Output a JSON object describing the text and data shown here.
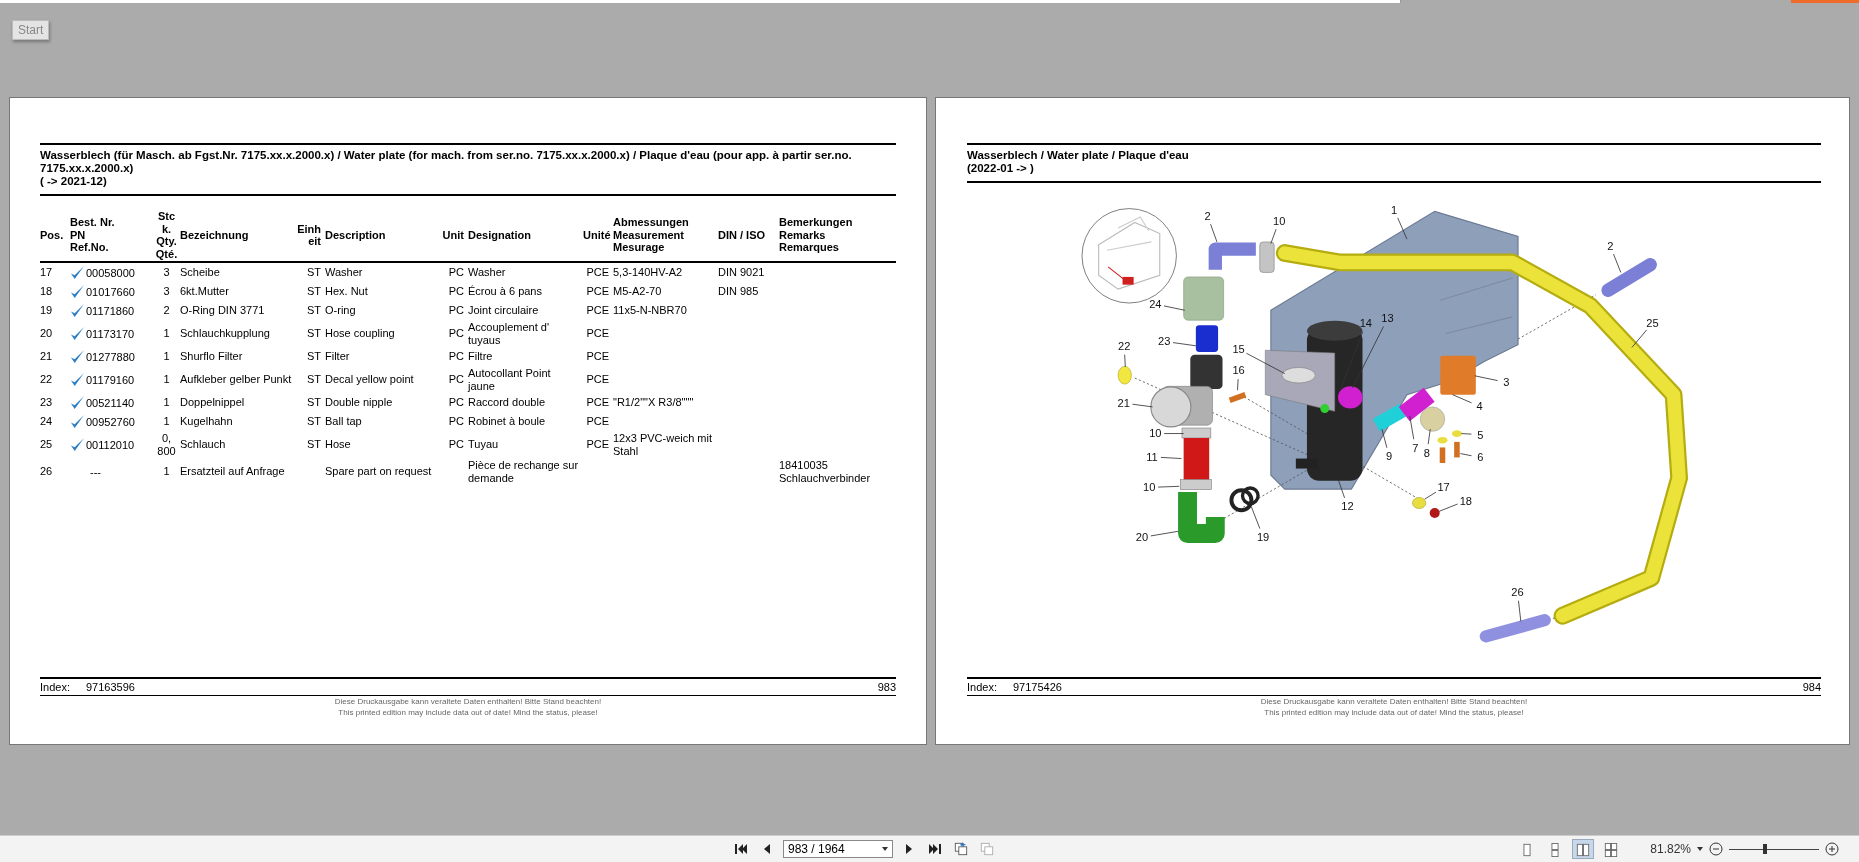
{
  "start_button": {
    "label": "Start"
  },
  "pages": [
    {
      "kind": "table",
      "title": "Wasserblech (für Masch. ab Fgst.Nr. 7175.xx.x.2000.x) / Water plate (for mach. from ser.no. 7175.xx.x.2000.x) / Plaque d'eau (pour app. à partir ser.no. 7175.xx.x.2000.x)",
      "subtitle": "( -> 2021-12)",
      "columns": [
        {
          "lines": [
            "Pos."
          ]
        },
        {
          "lines": [
            "Best. Nr.",
            "PN",
            "Ref.No."
          ]
        },
        {
          "lines": [
            "Stc",
            "k.",
            "Qty.",
            "Qté."
          ]
        },
        {
          "lines": [
            "Bezeichnung"
          ]
        },
        {
          "lines": [
            "Einh",
            "eit"
          ]
        },
        {
          "lines": [
            "Description"
          ]
        },
        {
          "lines": [
            "Unit"
          ]
        },
        {
          "lines": [
            "Designation"
          ]
        },
        {
          "lines": [
            "Unité"
          ]
        },
        {
          "lines": [
            "Abmessungen",
            "Measurement",
            "Mesurage"
          ]
        },
        {
          "lines": [
            "DIN / ISO"
          ]
        },
        {
          "lines": [
            "Bemerkungen",
            "Remarks",
            "Remarques"
          ]
        }
      ],
      "rows": [
        {
          "checked": true,
          "cells": [
            "17",
            "00058000",
            "3",
            "Scheibe",
            "ST",
            "Washer",
            "PC",
            "Washer",
            "PCE",
            "5,3-140HV-A2",
            "DIN 9021",
            ""
          ]
        },
        {
          "checked": true,
          "cells": [
            "18",
            "01017660",
            "3",
            "6kt.Mutter",
            "ST",
            "Hex. Nut",
            "PC",
            "Écrou à 6 pans",
            "PCE",
            "M5-A2-70",
            "DIN 985",
            ""
          ]
        },
        {
          "checked": true,
          "cells": [
            "19",
            "01171860",
            "2",
            "O-Ring DIN 3771",
            "ST",
            "O-ring",
            "PC",
            "Joint circulaire",
            "PCE",
            "11x5-N-NBR70",
            "",
            ""
          ]
        },
        {
          "checked": true,
          "cells": [
            "20",
            "01173170",
            "1",
            "Schlauchkupplung",
            "ST",
            "Hose coupling",
            "PC",
            "Accouplement d' tuyaus",
            "PCE",
            "",
            "",
            ""
          ]
        },
        {
          "checked": true,
          "cells": [
            "21",
            "01277880",
            "1",
            "Shurflo Filter",
            "ST",
            "Filter",
            "PC",
            "Filtre",
            "PCE",
            "",
            "",
            ""
          ]
        },
        {
          "checked": true,
          "cells": [
            "22",
            "01179160",
            "1",
            "Aufkleber gelber Punkt",
            "ST",
            "Decal yellow point",
            "PC",
            "Autocollant Point jaune",
            "PCE",
            "",
            "",
            ""
          ]
        },
        {
          "checked": true,
          "cells": [
            "23",
            "00521140",
            "1",
            "Doppelnippel",
            "ST",
            "Double nipple",
            "PC",
            "Raccord double",
            "PCE",
            "\"R1/2\"\"X R3/8\"\"\"",
            "",
            ""
          ]
        },
        {
          "checked": true,
          "cells": [
            "24",
            "00952760",
            "1",
            "Kugelhahn",
            "ST",
            "Ball tap",
            "PC",
            "Robinet à boule",
            "PCE",
            "",
            "",
            ""
          ]
        },
        {
          "checked": true,
          "cells": [
            "25",
            "00112010",
            "0, 800",
            "Schlauch",
            "ST",
            "Hose",
            "PC",
            "Tuyau",
            "PCE",
            "12x3 PVC-weich mit Stahl",
            "",
            ""
          ]
        },
        {
          "checked": false,
          "cells": [
            "26",
            "---",
            "1",
            "Ersatzteil auf Anfrage",
            "",
            "Spare part on request",
            "",
            "Pièce de rechange sur demande",
            "",
            "",
            "",
            "18410035 Schlauchverbinder"
          ]
        }
      ],
      "footer": {
        "index_label": "Index:",
        "index": "97163596",
        "page_number": "983",
        "notice": [
          "Diese Druckausgabe kann veraltete Daten enthalten! Bitte Stand beachten!",
          "This printed edition may include data out of date! Mind the status, please!"
        ]
      }
    },
    {
      "kind": "diagram",
      "title": "Wasserblech / Water plate / Plaque d'eau",
      "subtitle": "(2022-01 -> )",
      "callouts": [
        "1",
        "10",
        "2",
        "2",
        "25",
        "24",
        "22",
        "23",
        "15",
        "14",
        "13",
        "16",
        "3",
        "4",
        "5",
        "9",
        "7",
        "8",
        "6",
        "21",
        "10",
        "11",
        "10",
        "17",
        "18",
        "12",
        "20",
        "19",
        "26"
      ],
      "footer": {
        "index_label": "Index:",
        "index": "97175426",
        "page_number": "984",
        "notice": [
          "Diese Druckausgabe kann veraltete Daten enthalten! Bitte Stand beachten!",
          "This printed edition may include data out of date! Mind the status, please!"
        ]
      }
    }
  ],
  "toolbar": {
    "page_field": {
      "value": "983 / 1964"
    },
    "view_modes": [
      {
        "selected": false
      },
      {
        "selected": false
      },
      {
        "selected": true
      },
      {
        "selected": false
      }
    ],
    "zoom": {
      "value": "81.82%",
      "level": 0.4
    }
  }
}
